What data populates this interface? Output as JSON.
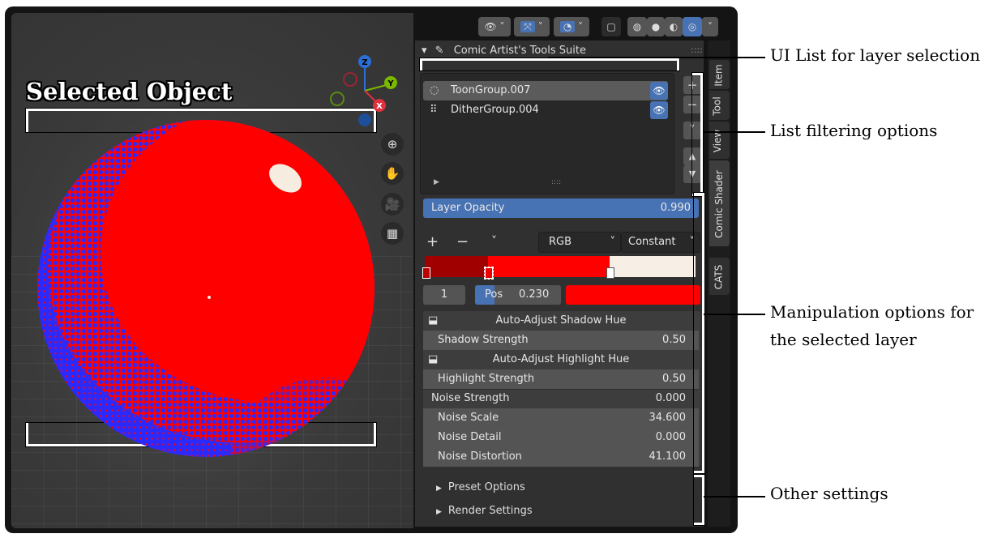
{
  "viewport": {
    "selected_label": "Selected Object",
    "gizmo": {
      "z": "Z",
      "y": "Y",
      "x": "X"
    },
    "nav_icons": [
      "zoom-icon",
      "pan-hand-icon",
      "camera-icon",
      "grid-ortho-icon"
    ]
  },
  "header": {
    "icons": [
      "visibility-icon",
      "gizmo-icon",
      "overlay-icon",
      "xray-icon",
      "wireframe-icon",
      "solid-icon",
      "material-icon",
      "rendered-icon"
    ]
  },
  "panel": {
    "title": "Comic Artist's Tools Suite",
    "layers": [
      {
        "name": "ToonGroup.007",
        "icon": "toon-icon",
        "selected": true
      },
      {
        "name": "DitherGroup.004",
        "icon": "dither-icon",
        "selected": false
      }
    ],
    "list_buttons": {
      "add": "+",
      "remove": "−"
    },
    "opacity": {
      "label": "Layer Opacity",
      "value": "0.990"
    },
    "ramp": {
      "add": "+",
      "remove": "−",
      "color_mode": "RGB",
      "interpolation": "Constant",
      "stop_index": "1",
      "pos_label": "Pos",
      "pos_value": "0.230",
      "stops": [
        "#a00000",
        "#ff0000",
        "#f7efe6"
      ]
    },
    "props": [
      {
        "type": "head",
        "label": "Auto-Adjust Shadow Hue"
      },
      {
        "type": "sub",
        "label": "Shadow Strength",
        "value": "0.50"
      },
      {
        "type": "head",
        "label": "Auto-Adjust Highlight Hue"
      },
      {
        "type": "sub",
        "label": "Highlight Strength",
        "value": "0.50"
      },
      {
        "type": "plain",
        "label": "Noise Strength",
        "value": "0.000"
      },
      {
        "type": "sub",
        "label": "Noise Scale",
        "value": "34.600"
      },
      {
        "type": "sub",
        "label": "Noise Detail",
        "value": "0.000"
      },
      {
        "type": "sub",
        "label": "Noise Distortion",
        "value": "41.100"
      }
    ],
    "collapsed": [
      "Preset Options",
      "Render Settings"
    ]
  },
  "tabs": [
    "Item",
    "Tool",
    "View",
    "Comic Shader",
    "CATS"
  ],
  "annotations": {
    "ui_list": "UI List for layer selection",
    "filter": "List filtering options",
    "manip_1": "Manipulation options for",
    "manip_2": "the selected layer",
    "other": "Other settings"
  },
  "colors": {
    "accent": "#4772b3",
    "sphere_red": "#ff0000",
    "sphere_blue": "#2a2aff"
  }
}
